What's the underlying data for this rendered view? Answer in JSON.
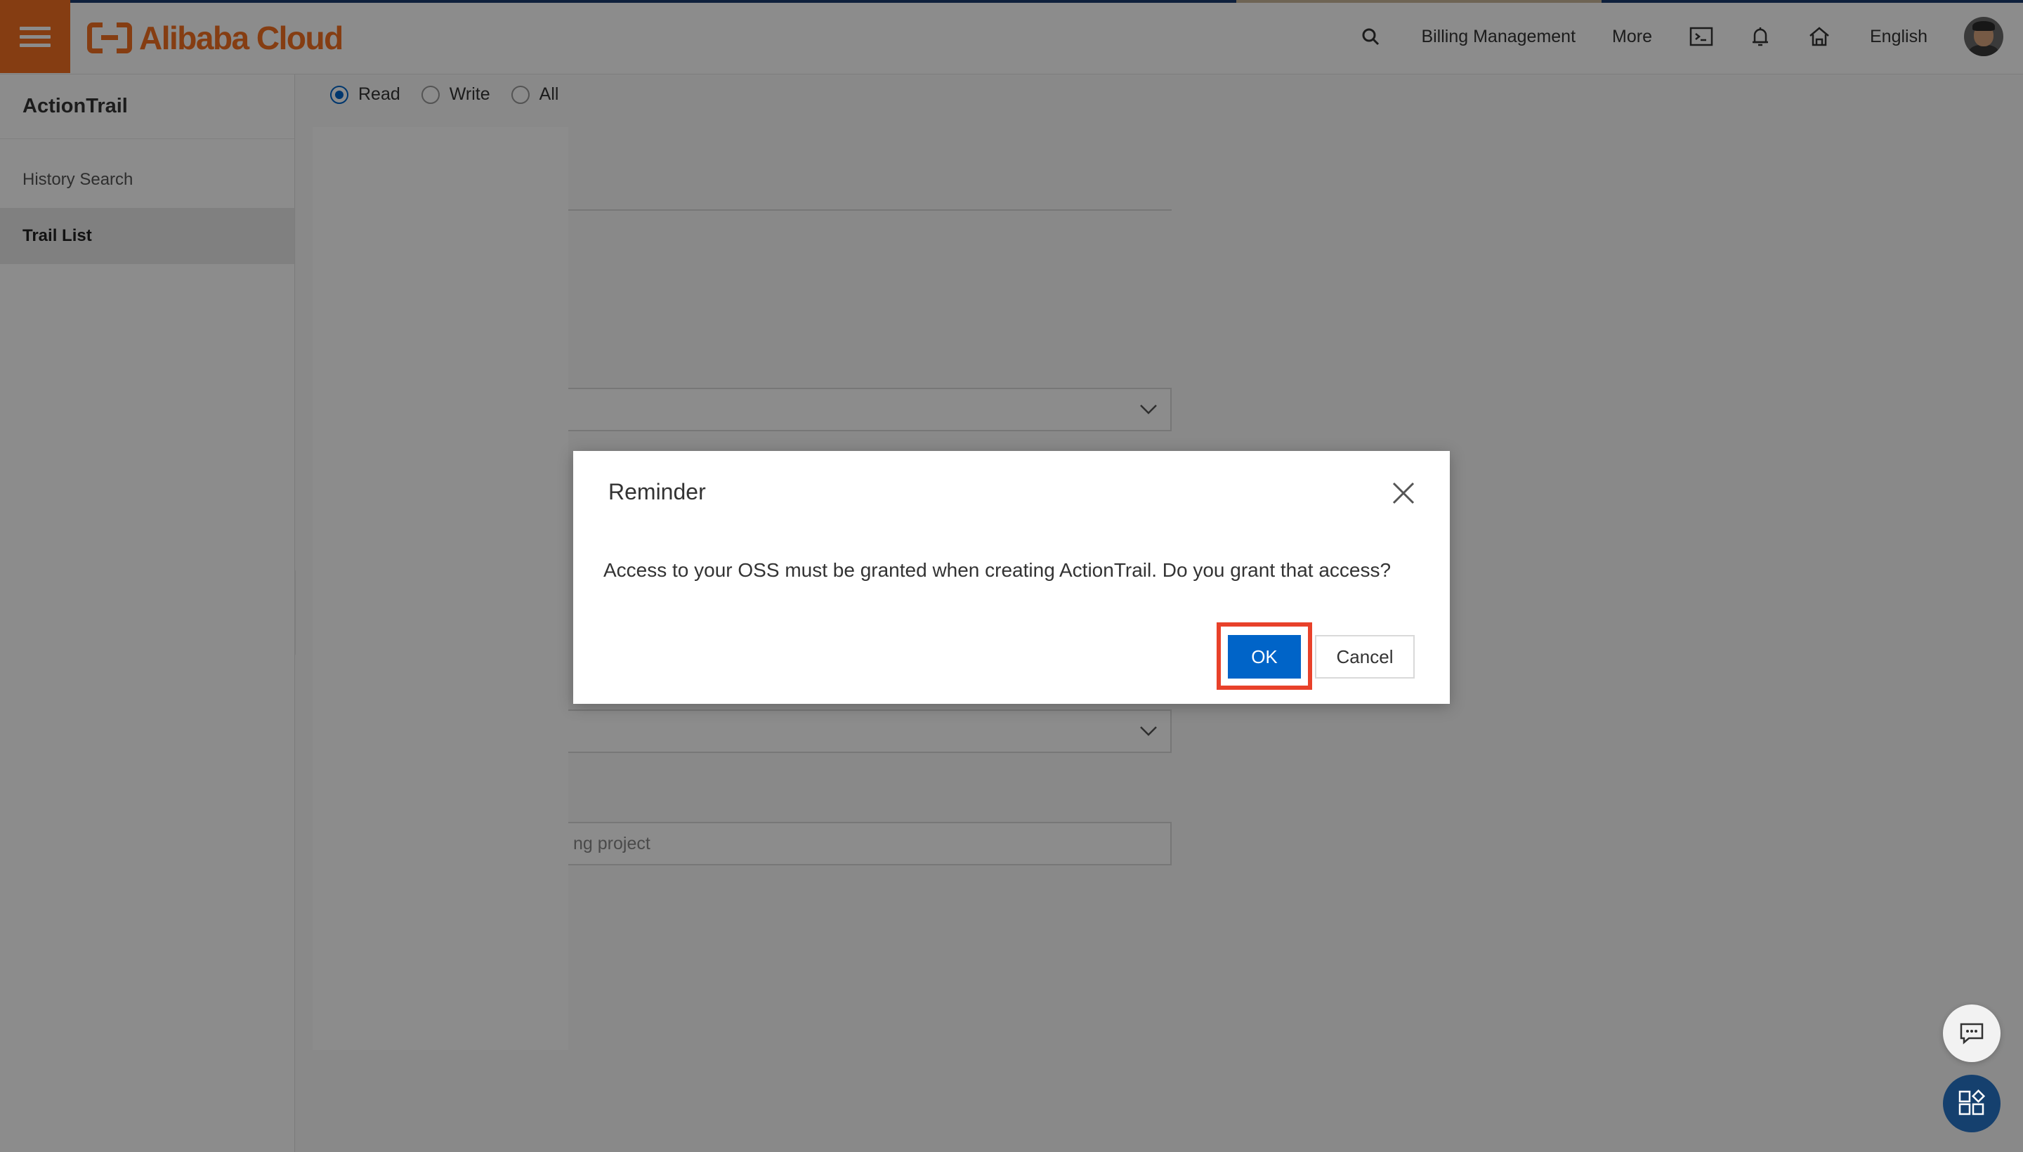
{
  "header": {
    "brand": "Alibaba Cloud",
    "nav": {
      "billing": "Billing Management",
      "more": "More",
      "language": "English"
    }
  },
  "sidebar": {
    "title": "ActionTrail",
    "items": [
      {
        "label": "History Search",
        "active": false
      },
      {
        "label": "Trail List",
        "active": true
      }
    ]
  },
  "form": {
    "event_type": {
      "options": [
        "Read",
        "Write",
        "All"
      ],
      "selected": "Read"
    },
    "project_input_value": "ng project"
  },
  "dialog": {
    "title": "Reminder",
    "message": "Access to your OSS must be granted when creating ActionTrail. Do you grant that access?",
    "ok_label": "OK",
    "cancel_label": "Cancel"
  },
  "colors": {
    "brand_orange": "#f27022",
    "primary_blue": "#0064c8",
    "highlight_red": "#e8412a",
    "apps_button": "#15406e"
  }
}
